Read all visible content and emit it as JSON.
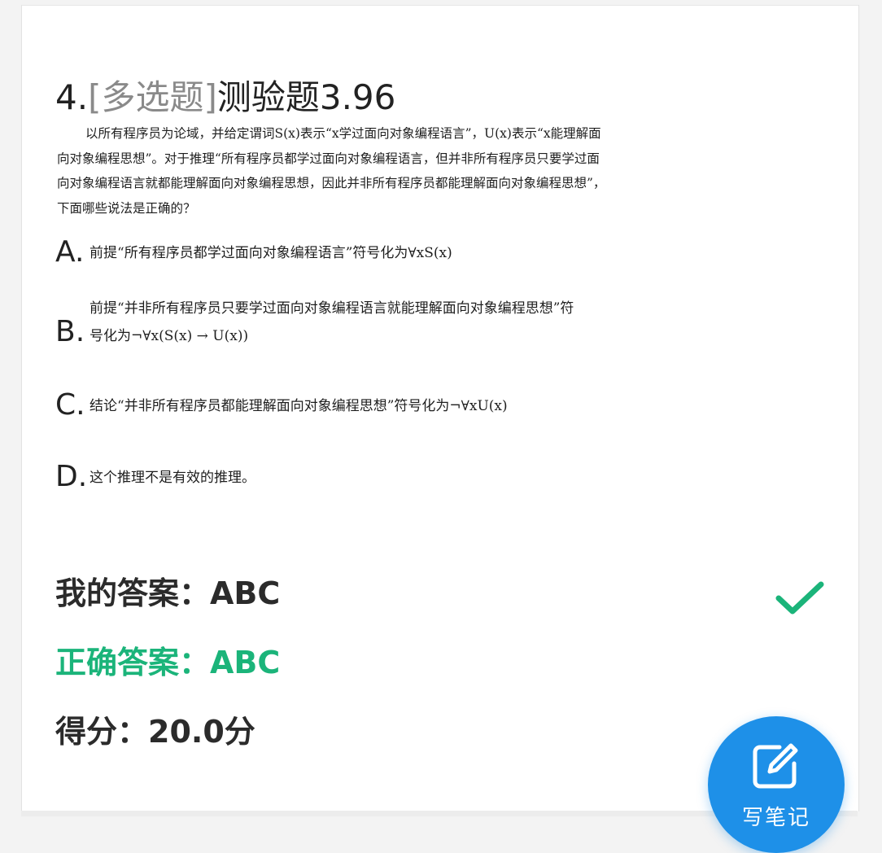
{
  "question": {
    "number": "4.",
    "type": "[多选题]",
    "title": "测验题3.96",
    "stem_lines": [
      "以所有程序员为论域，并给定谓词S(x)表示“x学过面向对象编程语言”，U(x)表示“x能理解面",
      "向对象编程思想”。对于推理“所有程序员都学过面向对象编程语言，但并非所有程序员只要学过面",
      "向对象编程语言就都能理解面向对象编程思想，因此并非所有程序员都能理解面向对象编程思想”，",
      "下面哪些说法是正确的？"
    ]
  },
  "options": [
    {
      "letter": "A.",
      "lines": [
        "前提“所有程序员都学过面向对象编程语言”符号化为∀xS(x)"
      ]
    },
    {
      "letter": "B.",
      "lines": [
        "前提“并非所有程序员只要学过面向对象编程语言就能理解面向对象编程思想”符",
        "号化为¬∀x(S(x) → U(x))"
      ]
    },
    {
      "letter": "C.",
      "lines": [
        "结论“并非所有程序员都能理解面向对象编程思想”符号化为¬∀xU(x)"
      ]
    },
    {
      "letter": "D.",
      "lines": [
        "这个推理不是有效的推理。"
      ]
    }
  ],
  "result": {
    "my_answer": "我的答案：ABC",
    "correct_answer": "正确答案：ABC",
    "score": "得分：20.0分"
  },
  "fab": {
    "label": "写笔记"
  },
  "colors": {
    "correct_green": "#1bb47a",
    "fab_blue": "#1e90e8",
    "check_green": "#1bb47a"
  },
  "icons": [
    "check-icon",
    "edit-icon"
  ]
}
